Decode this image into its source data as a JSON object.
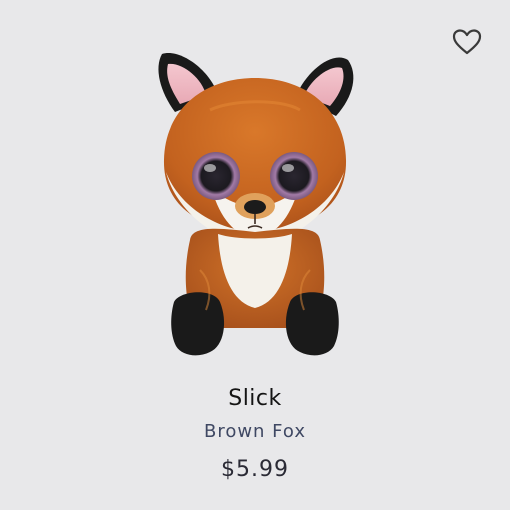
{
  "product": {
    "name": "Slick",
    "subtitle": "Brown Fox",
    "price": "$5.99",
    "image_icon": "plush-fox",
    "favorite_icon": "heart-outline-icon"
  },
  "colors": {
    "background": "#e8e8ea",
    "name_text": "#141414",
    "subtitle_text": "#3f4863",
    "price_text": "#2a2a35",
    "heart_stroke": "#3a3a3a"
  }
}
